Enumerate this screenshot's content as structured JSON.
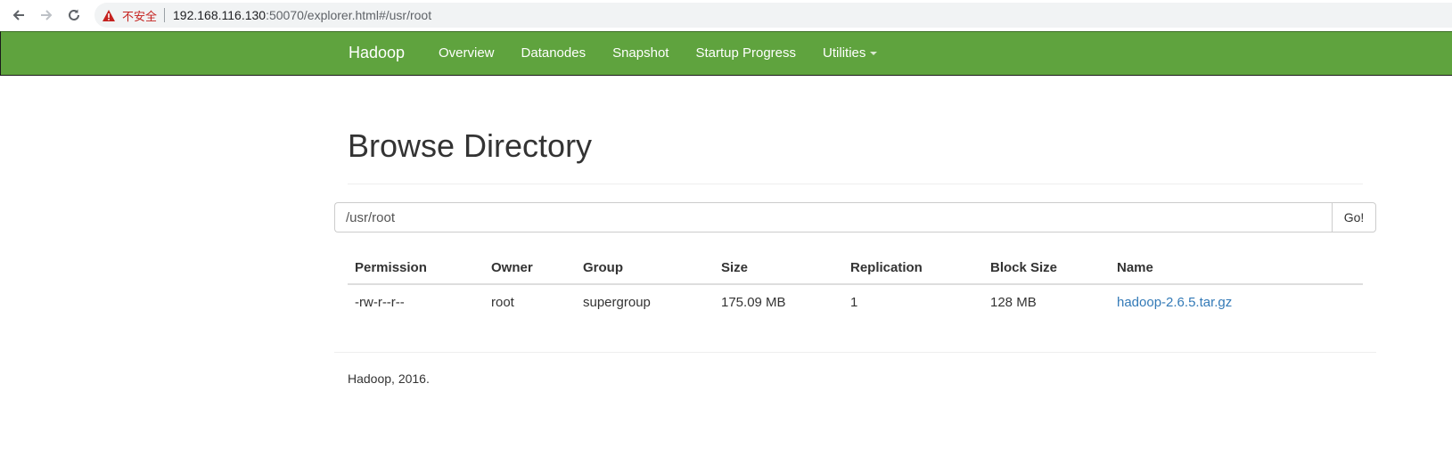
{
  "browser": {
    "security_label": "不安全",
    "url_host": "192.168.116.130",
    "url_rest": ":50070/explorer.html#/usr/root",
    "icons": {
      "back": "arrow-left-icon",
      "forward": "arrow-right-icon",
      "reload": "reload-icon",
      "warning": "warning-triangle-icon"
    }
  },
  "navbar": {
    "brand": "Hadoop",
    "links": [
      "Overview",
      "Datanodes",
      "Snapshot",
      "Startup Progress",
      "Utilities"
    ],
    "background": "#5fa33e"
  },
  "main": {
    "title": "Browse Directory",
    "path_value": "/usr/root",
    "go_label": "Go!"
  },
  "table": {
    "headers": [
      "Permission",
      "Owner",
      "Group",
      "Size",
      "Replication",
      "Block Size",
      "Name"
    ],
    "rows": [
      [
        "-rw-r--r--",
        "root",
        "supergroup",
        "175.09 MB",
        "1",
        "128 MB",
        "hadoop-2.6.5.tar.gz"
      ]
    ],
    "link_color": "#337ab7"
  },
  "footer": {
    "text": "Hadoop, 2016."
  }
}
